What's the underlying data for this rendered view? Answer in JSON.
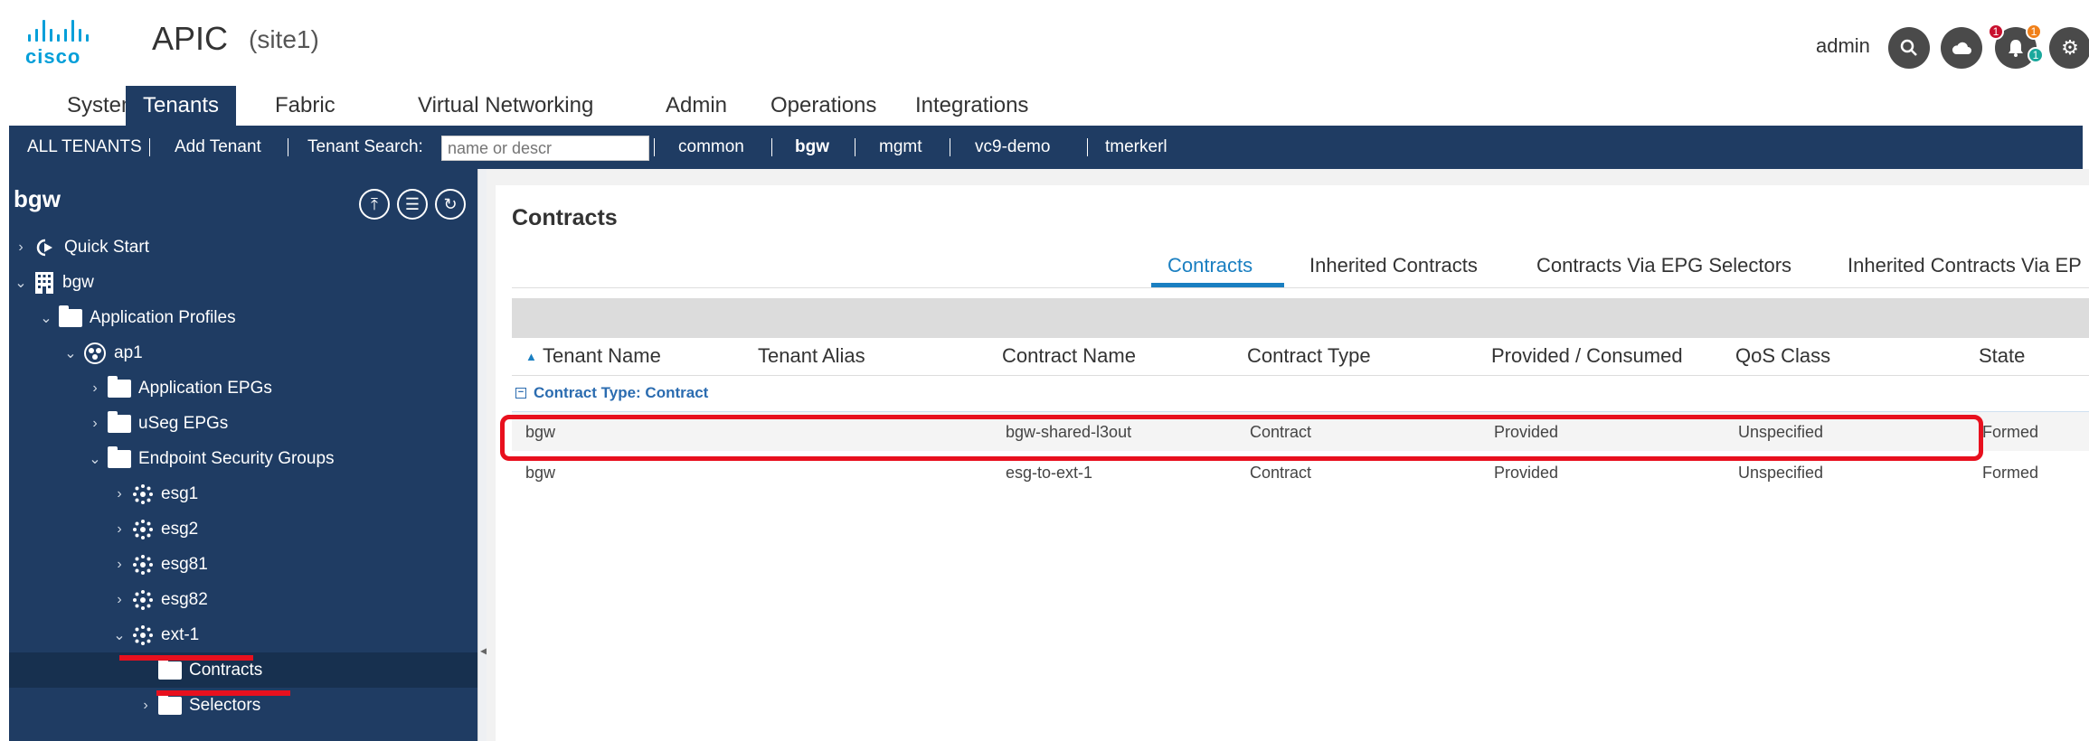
{
  "header": {
    "logo_text": "cisco",
    "app_title": "APIC",
    "site": "(site1)",
    "user": "admin",
    "notifications": {
      "red": "1",
      "orange": "1",
      "teal": "1"
    }
  },
  "nav_tabs": [
    "System",
    "Tenants",
    "Fabric",
    "Virtual Networking",
    "Admin",
    "Operations",
    "Integrations"
  ],
  "subnav": {
    "all_tenants": "ALL TENANTS",
    "add_tenant": "Add Tenant",
    "search_label": "Tenant Search:",
    "search_placeholder": "name or descr",
    "tenants": [
      "common",
      "bgw",
      "mgmt",
      "vc9-demo",
      "tmerkerl"
    ]
  },
  "sidebar": {
    "title": "bgw",
    "tree": [
      {
        "label": "Quick Start",
        "icon": "quick-start-icon",
        "chevron": "›"
      },
      {
        "label": "bgw",
        "icon": "tenant-building-icon",
        "chevron": "⌄"
      },
      {
        "label": "Application Profiles",
        "icon": "folder-icon",
        "chevron": "⌄"
      },
      {
        "label": "ap1",
        "icon": "app-profile-icon",
        "chevron": "⌄"
      },
      {
        "label": "Application EPGs",
        "icon": "folder-icon",
        "chevron": "›"
      },
      {
        "label": "uSeg EPGs",
        "icon": "folder-icon",
        "chevron": "›"
      },
      {
        "label": "Endpoint Security Groups",
        "icon": "folder-icon",
        "chevron": "⌄"
      },
      {
        "label": "esg1",
        "icon": "esg-icon",
        "chevron": "›"
      },
      {
        "label": "esg2",
        "icon": "esg-icon",
        "chevron": "›"
      },
      {
        "label": "esg81",
        "icon": "esg-icon",
        "chevron": "›"
      },
      {
        "label": "esg82",
        "icon": "esg-icon",
        "chevron": "›"
      },
      {
        "label": "ext-1",
        "icon": "esg-icon",
        "chevron": "⌄"
      },
      {
        "label": "Contracts",
        "icon": "folder-icon",
        "chevron": ""
      },
      {
        "label": "Selectors",
        "icon": "folder-icon",
        "chevron": "›"
      }
    ]
  },
  "main": {
    "title": "Contracts",
    "tabs": [
      "Contracts",
      "Inherited Contracts",
      "Contracts Via EPG Selectors",
      "Inherited Contracts Via EP"
    ],
    "sort_indicator": "▲",
    "columns": [
      "Tenant Name",
      "Tenant Alias",
      "Contract Name",
      "Contract Type",
      "Provided / Consumed",
      "QoS Class",
      "State"
    ],
    "group_label": "Contract Type: Contract",
    "rows": [
      [
        "bgw",
        "",
        "bgw-shared-l3out",
        "Contract",
        "Provided",
        "Unspecified",
        "Formed"
      ],
      [
        "bgw",
        "",
        "esg-to-ext-1",
        "Contract",
        "Provided",
        "Unspecified",
        "Formed"
      ]
    ]
  },
  "colors": {
    "navy": "#1f3c63",
    "accent": "#1a7fc1",
    "highlight": "#e8101e"
  }
}
